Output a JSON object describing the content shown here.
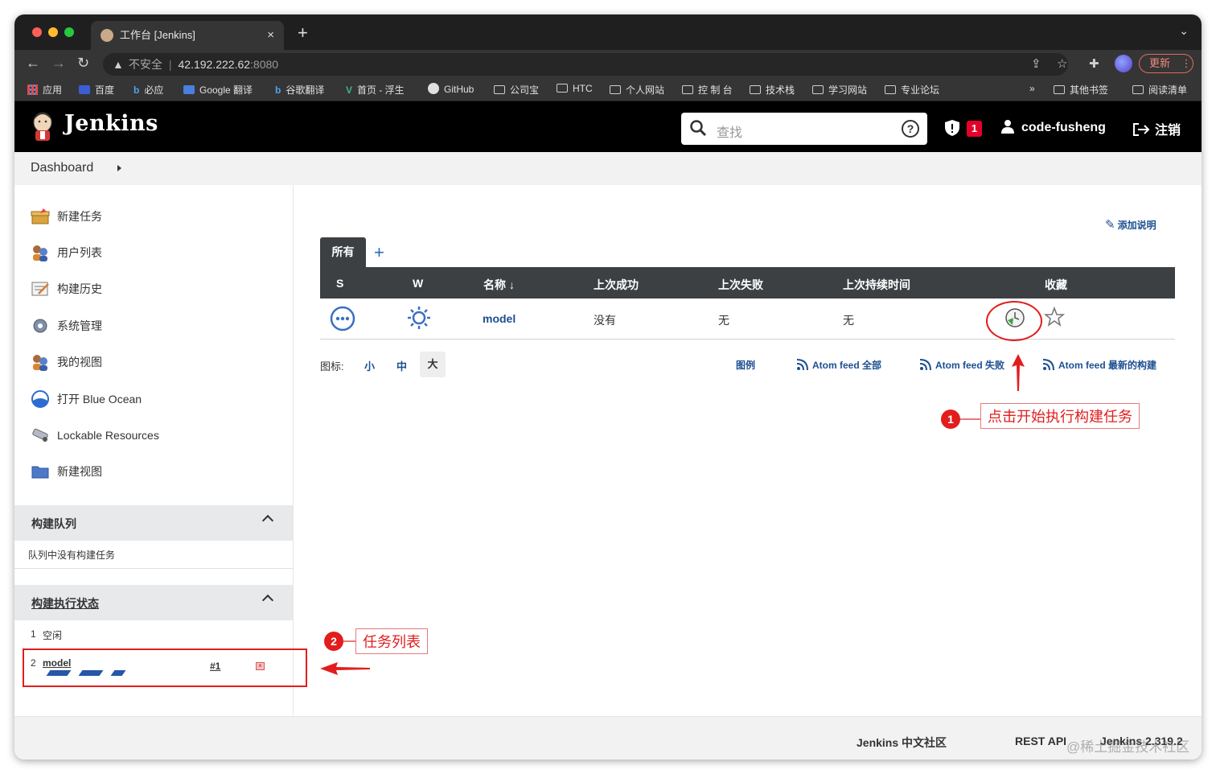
{
  "browser": {
    "tab_title": "工作台 [Jenkins]",
    "tab_close": "×",
    "new_tab": "+",
    "url_insecure": "不安全",
    "url_host": "42.192.222.62",
    "url_port": ":8080",
    "update_label": "更新",
    "update_more": "⋮",
    "bookmarks": [
      "应用",
      "百度",
      "必应",
      "Google 翻译",
      "谷歌翻译",
      "首页 - 浮生",
      "GitHub",
      "公司宝",
      "HTC",
      "个人网站",
      "控 制 台",
      "技术栈",
      "学习网站",
      "专业论坛"
    ],
    "bookmarks_more": "»",
    "bookmarks_right": [
      "其他书签",
      "阅读清单"
    ]
  },
  "header": {
    "title": "Jenkins",
    "search_placeholder": "查找",
    "help": "?",
    "alert_count": "1",
    "username": "code-fusheng",
    "logout": "注销"
  },
  "breadcrumb": {
    "item": "Dashboard"
  },
  "sidebar": {
    "tasks": [
      "新建任务",
      "用户列表",
      "构建历史",
      "系统管理",
      "我的视图",
      "打开 Blue Ocean",
      "Lockable Resources",
      "新建视图"
    ],
    "queue": {
      "title": "构建队列",
      "empty": "队列中没有构建任务"
    },
    "executors": {
      "title": "构建执行状态",
      "rows": [
        {
          "num": "1",
          "label": "空闲"
        },
        {
          "num": "2",
          "label": "model",
          "build": "#1"
        }
      ]
    }
  },
  "main": {
    "add_description": "添加说明",
    "view_tab": "所有",
    "view_add": "+",
    "columns": [
      "S",
      "W",
      "名称",
      "↓",
      "上次成功",
      "上次失败",
      "上次持续时间",
      "收藏"
    ],
    "rows": [
      {
        "name": "model",
        "last_success": "没有",
        "last_failure": "无",
        "last_duration": "无"
      }
    ],
    "icon_label": "图标:",
    "icon_sizes": [
      "小",
      "中",
      "大"
    ],
    "legend": "图例",
    "feeds": [
      "Atom feed 全部",
      "Atom feed 失败",
      "Atom feed 最新的构建"
    ]
  },
  "annotations": {
    "one": {
      "num": "1",
      "text": "点击开始执行构建任务"
    },
    "two": {
      "num": "2",
      "text": "任务列表"
    },
    "color": "#e21d1d"
  },
  "footer": {
    "community": "Jenkins 中文社区",
    "rest_api": "REST API",
    "version": "Jenkins 2.319.2"
  },
  "watermark": "@稀土掘金技术社区"
}
